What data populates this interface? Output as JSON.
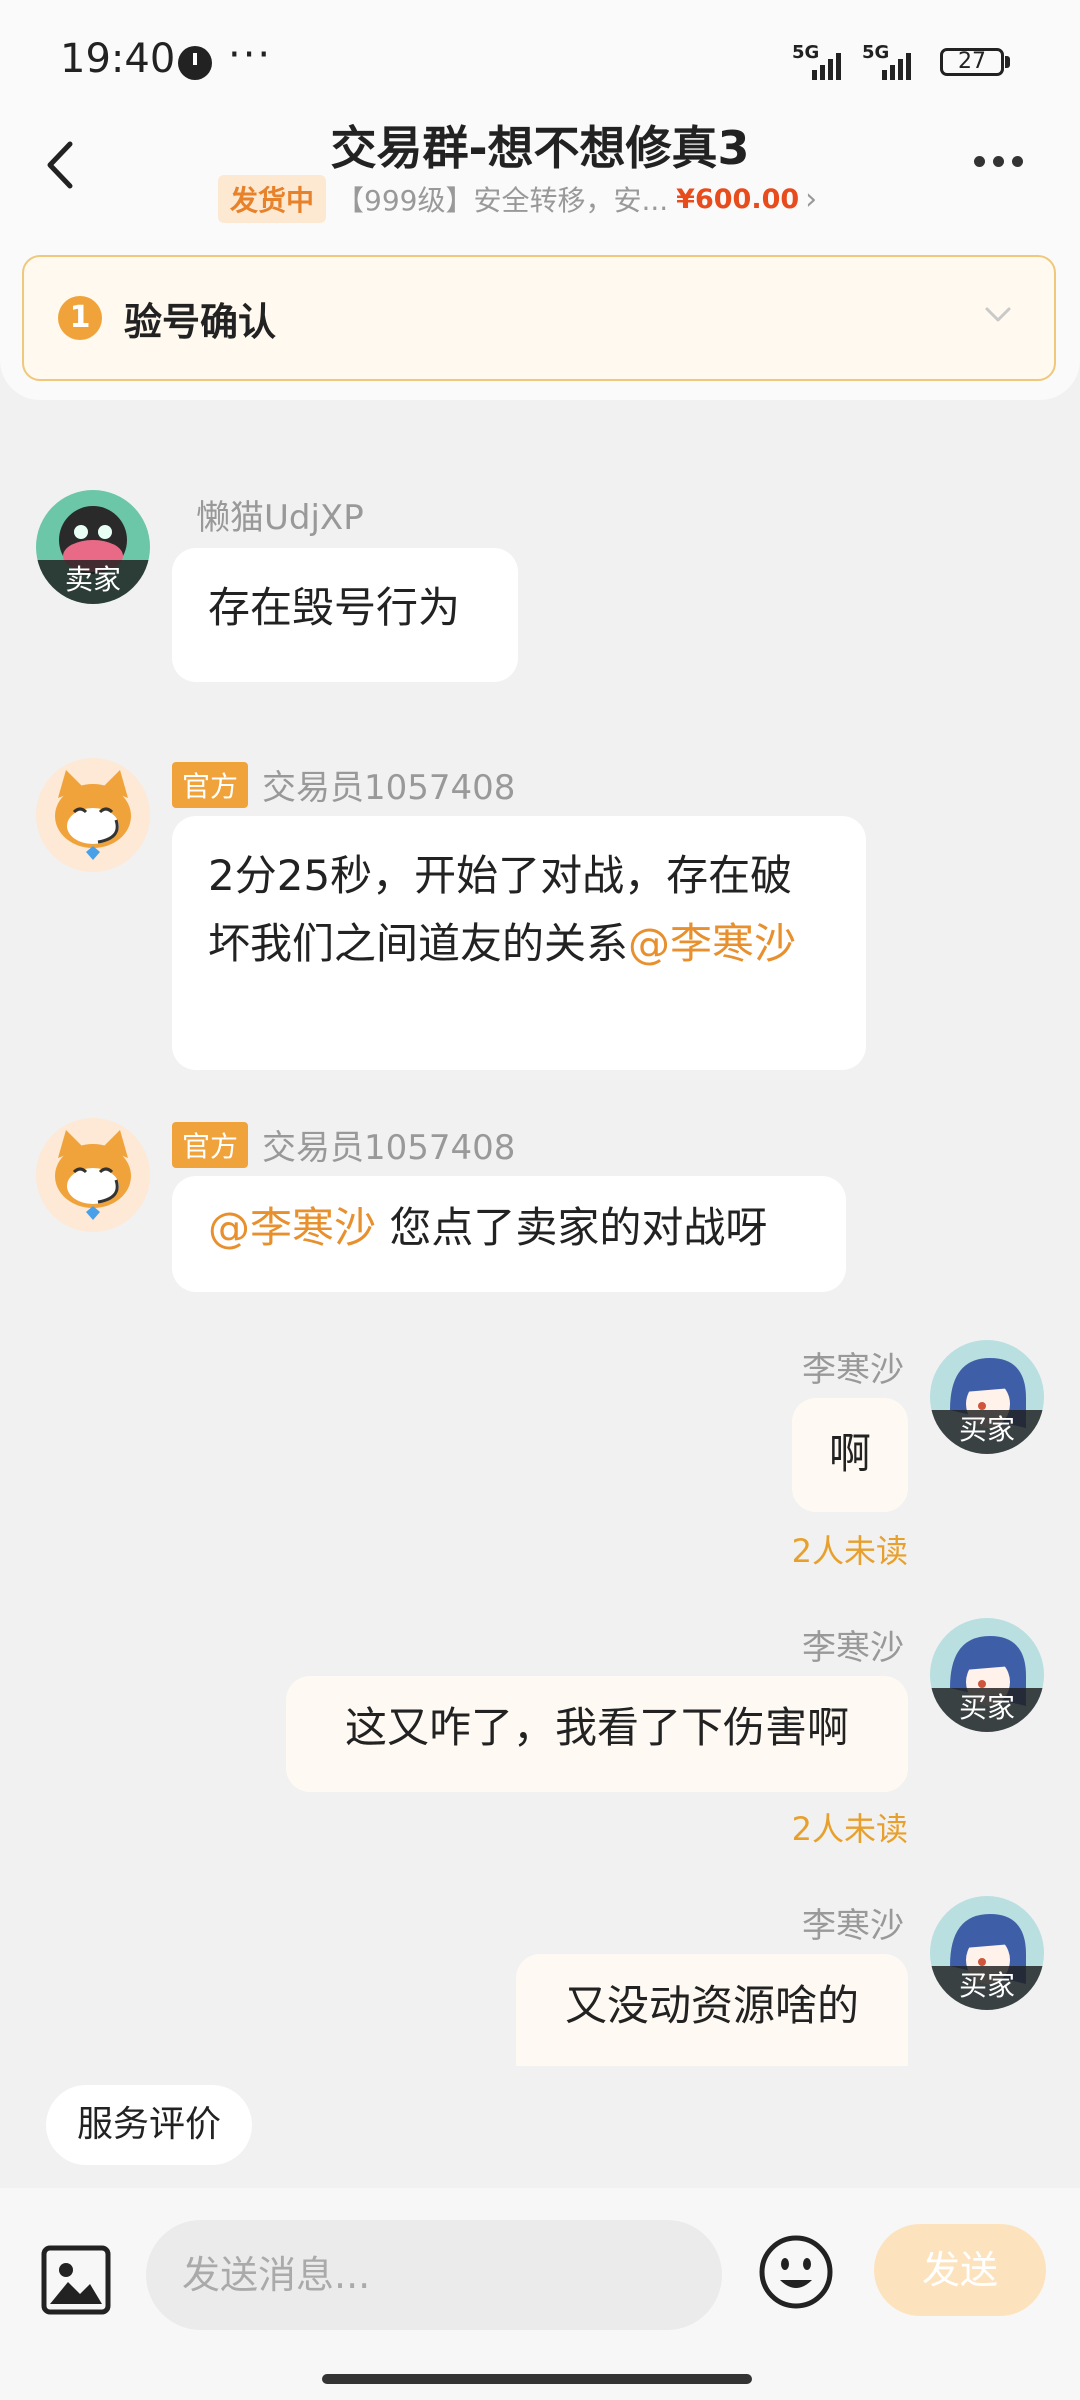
{
  "status_bar": {
    "time": "19:40",
    "more": "···",
    "network_labels": [
      "5G",
      "5G"
    ],
    "battery": "27"
  },
  "header": {
    "title": "交易群-想不想修真3",
    "order_status": "发货中",
    "order_desc": "【999级】安全转移，安...",
    "order_price": "¥600.00",
    "chevron": "›"
  },
  "confirm_bar": {
    "step": "1",
    "label": "验号确认"
  },
  "messages": [
    {
      "side": "left",
      "avatar_tag": "卖家",
      "name": "懒猫UdjXP",
      "text": "存在毁号行为"
    },
    {
      "side": "left",
      "badge": "官方",
      "name": "交易员1057408",
      "text_before": "2分25秒，开始了对战，存在破坏我们之间道友的关系",
      "mention": "@李寒沙"
    },
    {
      "side": "left",
      "badge": "官方",
      "name": "交易员1057408",
      "mention": "@李寒沙",
      "text_after": " 您点了卖家的对战呀"
    },
    {
      "side": "right",
      "avatar_tag": "买家",
      "name": "李寒沙",
      "text": "啊",
      "status": "2人未读"
    },
    {
      "side": "right",
      "avatar_tag": "买家",
      "name": "李寒沙",
      "text": "这又咋了，我看了下伤害啊",
      "status": "2人未读"
    },
    {
      "side": "right",
      "avatar_tag": "买家",
      "name": "李寒沙",
      "text": "又没动资源啥的"
    }
  ],
  "quick_actions": {
    "review": "服务评价"
  },
  "composer": {
    "placeholder": "发送消息...",
    "send_label": "发送",
    "icons": [
      "image-icon",
      "emoji-icon"
    ]
  },
  "colors": {
    "accent": "#f0a33a",
    "mention": "#e8902d",
    "price": "#e84b1c",
    "send_disabled": "#fde3bd"
  }
}
